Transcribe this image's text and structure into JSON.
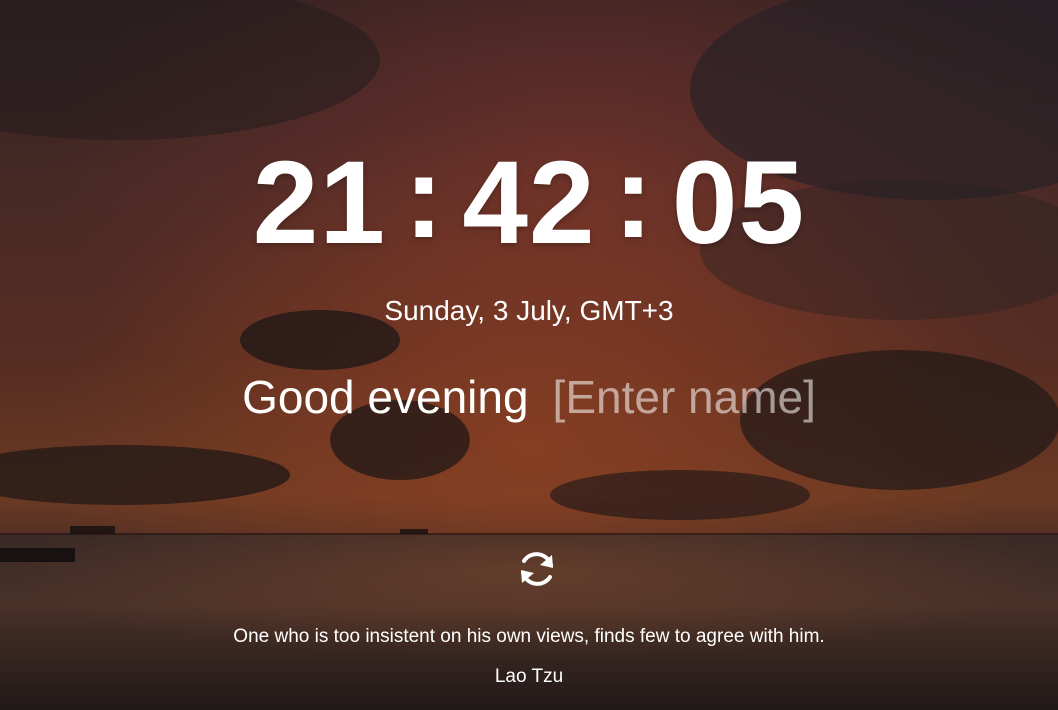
{
  "clock": {
    "hours": "21",
    "minutes": "42",
    "seconds": "05",
    "separator": ":"
  },
  "date": "Sunday, 3 July, GMT+3",
  "greeting": {
    "text": "Good evening",
    "name_placeholder": "[Enter name]"
  },
  "refresh": {
    "icon": "refresh-icon"
  },
  "quote": {
    "text": "One who is too insistent on his own views, finds few to agree with him.",
    "author": "Lao Tzu"
  },
  "theme": {
    "text_color": "#ffffff",
    "placeholder_color": "rgba(255,255,255,0.55)"
  }
}
